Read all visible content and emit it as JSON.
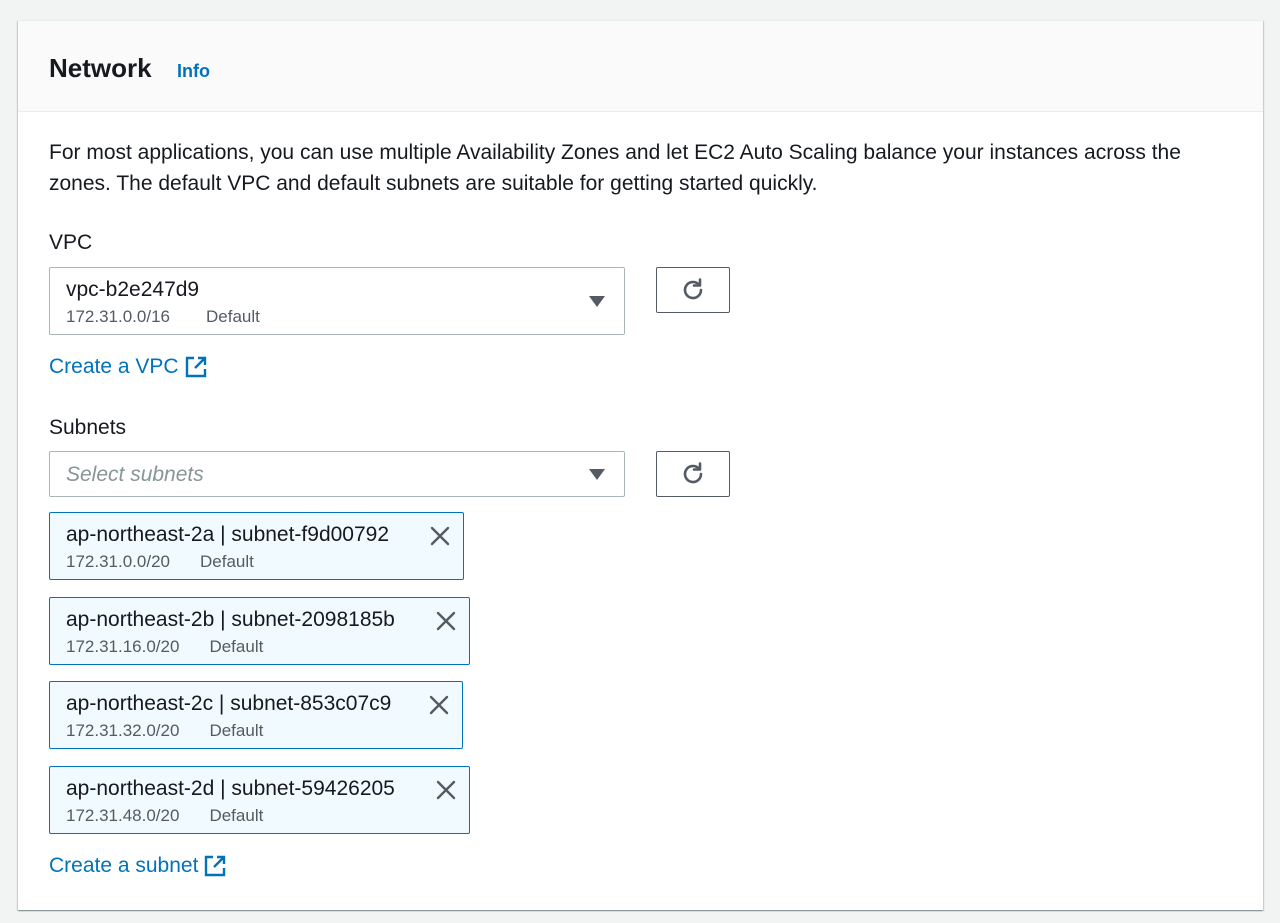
{
  "header": {
    "title": "Network",
    "info_label": "Info"
  },
  "description": "For most applications, you can use multiple Availability Zones and let EC2 Auto Scaling balance your instances across the zones. The default VPC and default subnets are suitable for getting started quickly.",
  "vpc": {
    "label": "VPC",
    "selected_id": "vpc-b2e247d9",
    "selected_cidr": "172.31.0.0/16",
    "selected_tag": "Default",
    "create_link": "Create a VPC"
  },
  "subnets": {
    "label": "Subnets",
    "placeholder": "Select subnets",
    "create_link": "Create a subnet",
    "selected": [
      {
        "name": "ap-northeast-2a | subnet-f9d00792",
        "cidr": "172.31.0.0/20",
        "tag": "Default"
      },
      {
        "name": "ap-northeast-2b | subnet-2098185b",
        "cidr": "172.31.16.0/20",
        "tag": "Default"
      },
      {
        "name": "ap-northeast-2c | subnet-853c07c9",
        "cidr": "172.31.32.0/20",
        "tag": "Default"
      },
      {
        "name": "ap-northeast-2d | subnet-59426205",
        "cidr": "172.31.48.0/20",
        "tag": "Default"
      }
    ]
  },
  "icons": {
    "refresh": "refresh-icon",
    "external": "external-link-icon",
    "dismiss": "close-icon",
    "caret": "caret-down-icon"
  },
  "colors": {
    "link": "#0073bb",
    "token_bg": "#f1faff",
    "token_border": "#0073bb",
    "text": "#16191f",
    "secondary_text": "#545b64"
  }
}
